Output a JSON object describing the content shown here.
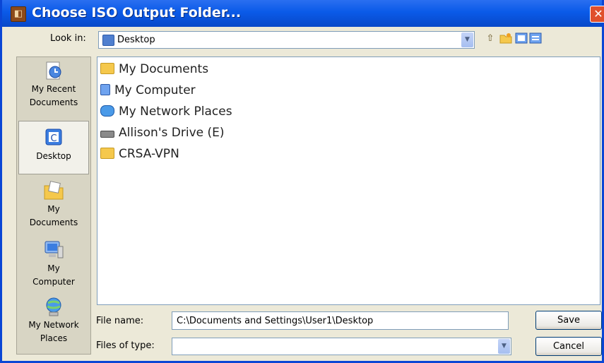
{
  "window": {
    "title": "Choose ISO Output Folder...",
    "close_glyph": "✕"
  },
  "lookin": {
    "label": "Look in:",
    "value": "Desktop",
    "dropdown_glyph": "▼"
  },
  "toolbar": {
    "icons": [
      "up-folder-icon",
      "new-folder-icon",
      "view-menu-icon"
    ]
  },
  "places": [
    {
      "label": "My Recent Documents",
      "icon": "recent-documents-icon"
    },
    {
      "label": "Desktop",
      "icon": "desktop-icon",
      "selected": true
    },
    {
      "label": "My Documents",
      "icon": "my-documents-icon"
    },
    {
      "label": "My Computer",
      "icon": "my-computer-icon"
    },
    {
      "label": "My Network Places",
      "icon": "network-places-icon"
    }
  ],
  "files": [
    {
      "name": "My Documents",
      "icon": "my-documents-icon"
    },
    {
      "name": "My Computer",
      "icon": "my-computer-icon"
    },
    {
      "name": "My Network Places",
      "icon": "network-places-icon"
    },
    {
      "name": "Allison's Drive (E)",
      "icon": "drive-icon"
    },
    {
      "name": "CRSA-VPN",
      "icon": "folder-icon"
    }
  ],
  "filename": {
    "label": "File name:",
    "value": "C:\\Documents and Settings\\User1\\Desktop"
  },
  "filetype": {
    "label": "Files of type:",
    "value": "",
    "dropdown_glyph": "▼"
  },
  "buttons": {
    "save": "Save",
    "cancel": "Cancel"
  },
  "colors": {
    "titlebar": "#0a5ae8",
    "dialog_bg": "#ece9d8",
    "folder": "#f5c84c"
  }
}
